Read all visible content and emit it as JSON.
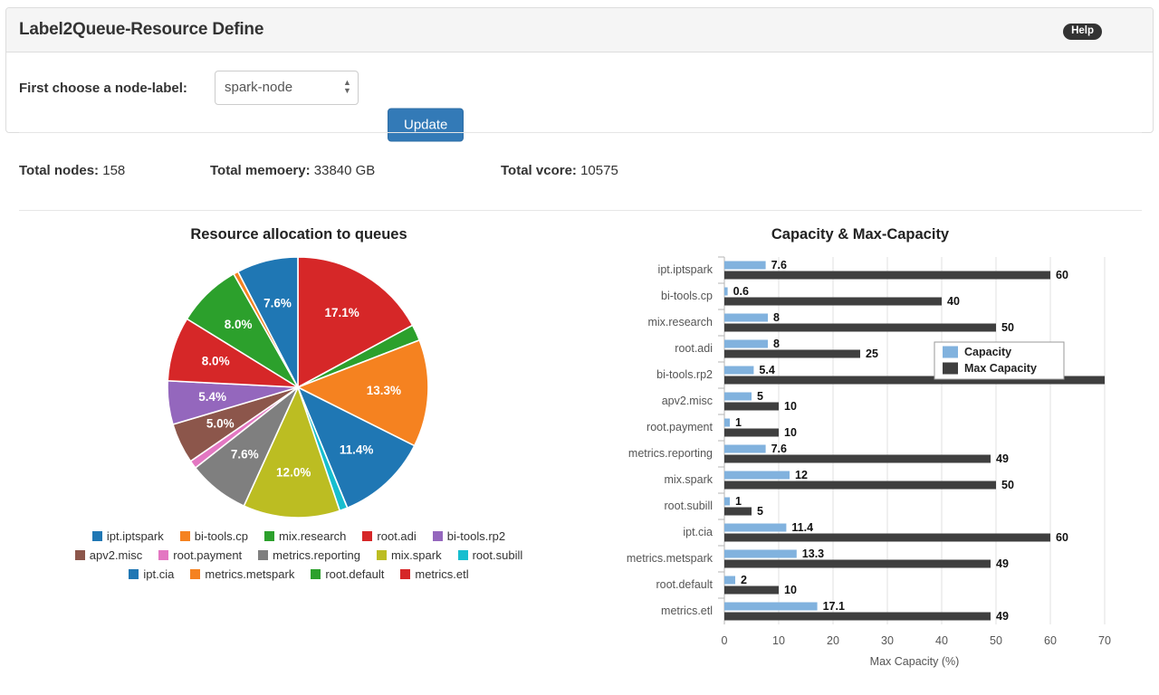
{
  "panel": {
    "title": "Label2Queue-Resource Define",
    "help_label": "Help"
  },
  "controls": {
    "node_label_text": "First choose a node-label:",
    "node_select_value": "spark-node",
    "node_select_options": [
      "spark-node"
    ],
    "update_button": "Update"
  },
  "totals": [
    {
      "label": "Total nodes:",
      "value": "158"
    },
    {
      "label": "Total memoery:",
      "value": "33840 GB"
    },
    {
      "label": "Total vcore:",
      "value": "10575"
    }
  ],
  "colors": {
    "accent": "#337ab7",
    "panel_head_bg": "#f5f5f5",
    "help_bg": "#333333",
    "capacity_bar": "#81b2de",
    "max_capacity_bar": "#3f3f3f"
  },
  "chart_data": [
    {
      "type": "pie",
      "title": "Resource allocation to queues",
      "legend_position": "bottom",
      "categories": [
        "ipt.iptspark",
        "bi-tools.cp",
        "mix.research",
        "root.adi",
        "bi-tools.rp2",
        "apv2.misc",
        "root.payment",
        "metrics.reporting",
        "mix.spark",
        "root.subill",
        "ipt.cia",
        "metrics.metspark",
        "root.default",
        "metrics.etl"
      ],
      "values": [
        7.6,
        0.6,
        8.0,
        8.0,
        5.4,
        5.0,
        1.0,
        7.6,
        12.0,
        1.0,
        11.4,
        13.3,
        2.0,
        17.1
      ],
      "colors": [
        "#1f77b4",
        "#f58220",
        "#2ca02c",
        "#d62728",
        "#9467bd",
        "#8c564b",
        "#e377c2",
        "#7f7f7f",
        "#bcbd22",
        "#17becf",
        "#1f77b4",
        "#f58220",
        "#2ca02c",
        "#d62728"
      ],
      "slice_labels": [
        "7.6%",
        "",
        "8.0%",
        "8.0%",
        "5.4%",
        "5.0%",
        "",
        "7.6%",
        "12.0%",
        "",
        "11.4%",
        "13.3%",
        "",
        "17.1%"
      ]
    },
    {
      "type": "bar",
      "orientation": "horizontal",
      "title": "Capacity & Max-Capacity",
      "xlabel": "Max Capacity (%)",
      "ylabel": "",
      "xlim": [
        0,
        70
      ],
      "xticks": [
        0,
        10,
        20,
        30,
        40,
        50,
        60,
        70
      ],
      "grid": true,
      "legend_position": "inside-right",
      "categories": [
        "ipt.iptspark",
        "bi-tools.cp",
        "mix.research",
        "root.adi",
        "bi-tools.rp2",
        "apv2.misc",
        "root.payment",
        "metrics.reporting",
        "mix.spark",
        "root.subill",
        "ipt.cia",
        "metrics.metspark",
        "root.default",
        "metrics.etl"
      ],
      "series": [
        {
          "name": "Capacity",
          "color": "#81b2de",
          "values": [
            7.6,
            0.6,
            8,
            8,
            5.4,
            5,
            1,
            7.6,
            12,
            1,
            11.4,
            13.3,
            2,
            17.1
          ],
          "labels": [
            "7.6",
            "0.6",
            "8",
            "8",
            "5.4",
            "5",
            "1",
            "7.6",
            "12",
            "1",
            "11.4",
            "13.3",
            "2",
            "17.1"
          ]
        },
        {
          "name": "Max Capacity",
          "color": "#3f3f3f",
          "values": [
            60,
            40,
            50,
            25,
            70,
            10,
            10,
            49,
            50,
            5,
            60,
            49,
            10,
            49
          ],
          "labels": [
            "60",
            "40",
            "50",
            "25",
            "",
            "10",
            "10",
            "49",
            "50",
            "5",
            "60",
            "49",
            "10",
            "49"
          ]
        }
      ]
    }
  ]
}
